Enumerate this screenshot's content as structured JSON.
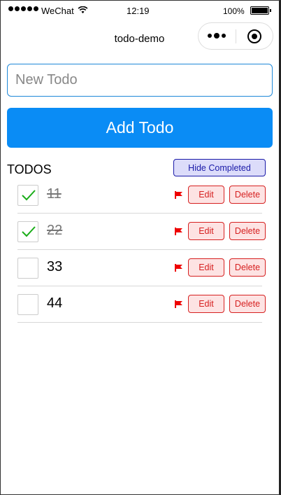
{
  "status_bar": {
    "carrier": "WeChat",
    "time": "12:19",
    "battery": "100%",
    "icons": [
      "signal-dots-icon",
      "wifi-icon",
      "battery-icon"
    ]
  },
  "nav": {
    "title": "todo-demo",
    "icons": [
      "more-dots-icon",
      "close-target-icon"
    ]
  },
  "input": {
    "placeholder": "New Todo",
    "value": ""
  },
  "add_button": {
    "label": "Add Todo",
    "color": "#0a8cf5"
  },
  "list": {
    "title": "TODOS",
    "hide_completed_label": "Hide Completed",
    "items": [
      {
        "text": "11",
        "completed": true,
        "flag_icon": "red-flag-icon",
        "edit_label": "Edit",
        "delete_label": "Delete"
      },
      {
        "text": "22",
        "completed": true,
        "flag_icon": "red-flag-icon",
        "edit_label": "Edit",
        "delete_label": "Delete"
      },
      {
        "text": "33",
        "completed": false,
        "flag_icon": "red-flag-icon",
        "edit_label": "Edit",
        "delete_label": "Delete"
      },
      {
        "text": "44",
        "completed": false,
        "flag_icon": "red-flag-icon",
        "edit_label": "Edit",
        "delete_label": "Delete"
      }
    ]
  },
  "colors": {
    "accent": "#0a8cf5",
    "danger": "#d62020",
    "check": "#1aad19"
  }
}
